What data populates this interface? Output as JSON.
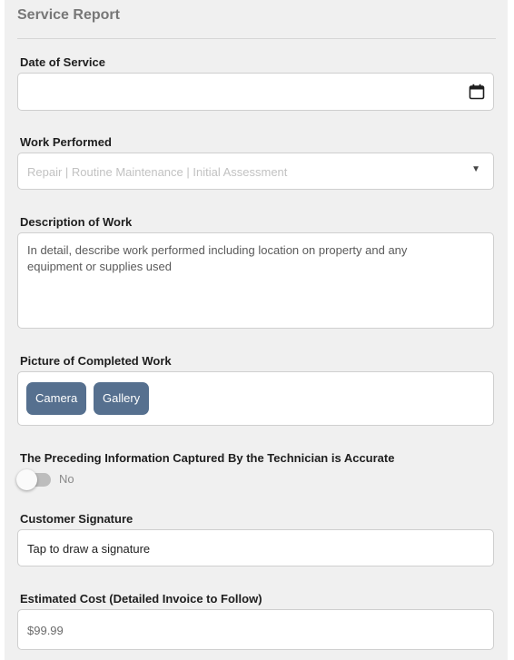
{
  "form": {
    "title": "Service Report"
  },
  "date_of_service": {
    "label": "Date of Service",
    "value": "",
    "icon": "calendar-icon"
  },
  "work_performed": {
    "label": "Work Performed",
    "placeholder": "Repair | Routine Maintenance | Initial Assessment",
    "icon": "dropdown-caret-icon",
    "caret_glyph": "▼"
  },
  "description": {
    "label": "Description of Work",
    "placeholder": "In detail, describe work performed including location on property and any equipment or supplies used"
  },
  "picture": {
    "label": "Picture of Completed Work",
    "camera_label": "Camera",
    "gallery_label": "Gallery"
  },
  "accuracy": {
    "label": "The Preceding Information Captured By the Technician is Accurate",
    "toggle_state": "No"
  },
  "signature": {
    "label": "Customer Signature",
    "prompt": "Tap to draw a signature"
  },
  "estimated_cost": {
    "label": "Estimated Cost (Detailed Invoice to Follow)",
    "placeholder": "$99.99"
  },
  "colors": {
    "background": "#f0f0f0",
    "button": "#56708f",
    "field_border": "#cfcfcf",
    "toggle_track": "#bdbdbd"
  }
}
